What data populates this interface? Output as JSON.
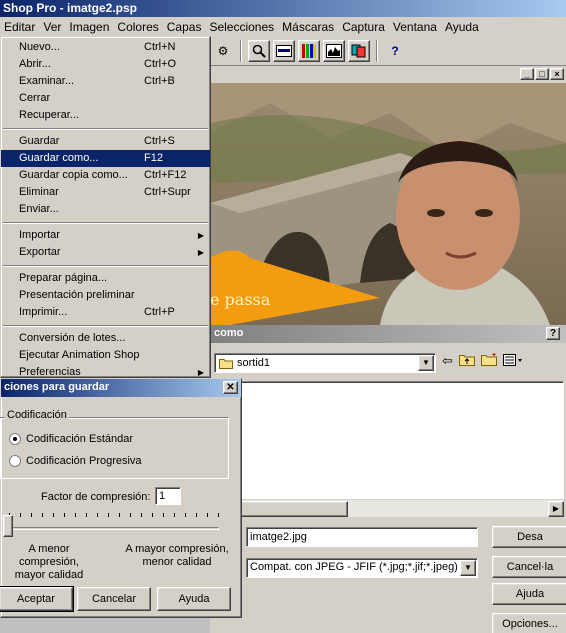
{
  "app": {
    "title": "Shop Pro - imatge2.psp"
  },
  "menubar": [
    "Editar",
    "Ver",
    "Imagen",
    "Colores",
    "Capas",
    "Selecciones",
    "Máscaras",
    "Captura",
    "Ventana",
    "Ayuda"
  ],
  "photo": {
    "caption": "e passa"
  },
  "file_menu": {
    "items": [
      {
        "label": "Nuevo...",
        "shortcut": "Ctrl+N"
      },
      {
        "label": "Abrir...",
        "shortcut": "Ctrl+O"
      },
      {
        "label": "Examinar...",
        "shortcut": "Ctrl+B"
      },
      {
        "label": "Cerrar",
        "shortcut": ""
      },
      {
        "label": "Recuperar...",
        "shortcut": ""
      },
      {
        "label": "Guardar",
        "shortcut": "Ctrl+S"
      },
      {
        "label": "Guardar como...",
        "shortcut": "F12",
        "highlighted": true
      },
      {
        "label": "Guardar copia como...",
        "shortcut": "Ctrl+F12"
      },
      {
        "label": "Eliminar",
        "shortcut": "Ctrl+Supr"
      },
      {
        "label": "Enviar...",
        "shortcut": ""
      },
      {
        "label": "Importar",
        "shortcut": "",
        "submenu": true
      },
      {
        "label": "Exportar",
        "shortcut": "",
        "submenu": true
      },
      {
        "label": "Preparar página...",
        "shortcut": ""
      },
      {
        "label": "Presentación preliminar",
        "shortcut": ""
      },
      {
        "label": "Imprimir...",
        "shortcut": "Ctrl+P"
      },
      {
        "label": "Conversión de lotes...",
        "shortcut": ""
      },
      {
        "label": "Ejecutar Animation Shop",
        "shortcut": ""
      },
      {
        "label": "Preferencias",
        "shortcut": "",
        "submenu": true
      }
    ]
  },
  "save_dialog": {
    "title": "como",
    "help": "?",
    "folder": "sortid1",
    "filename": "imatge2.jpg",
    "filetype": "Compat. con JPEG - JFIF (*.jpg;*.jif;*.jpeg)",
    "buttons": {
      "save": "Desa",
      "cancel": "Cancel·la",
      "help": "Ajuda",
      "options": "Opciones..."
    }
  },
  "options_dialog": {
    "title": "ciones para guardar",
    "close": "✕",
    "group": "Codificación",
    "standard": "Codificación Estándar",
    "progressive": "Codificación Progresiva",
    "selected": "standard",
    "factor_label": "Factor de compresión:",
    "factor_value": "1",
    "compression_fraction": 0.0,
    "left_line1": "A menor compresión,",
    "left_line2": "mayor calidad",
    "right_line1": "A mayor compresión,",
    "right_line2": "menor calidad",
    "ok": "Aceptar",
    "cancel": "Cancelar",
    "help": "Ayuda"
  }
}
